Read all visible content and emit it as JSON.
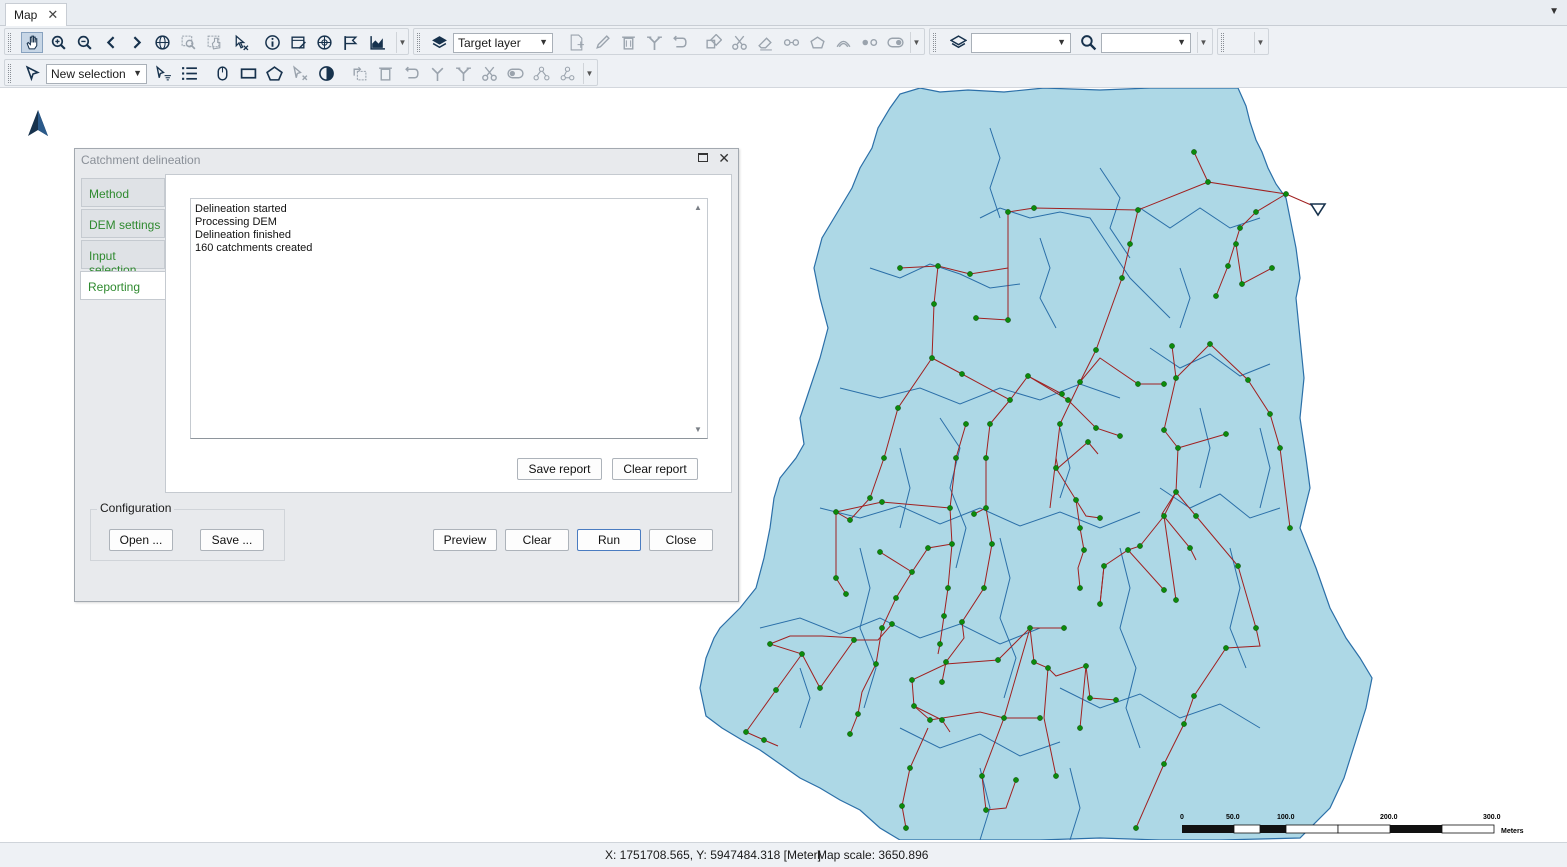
{
  "tab": {
    "title": "Map",
    "close": "✕",
    "menu_arrow": "▼"
  },
  "toolbar1": {
    "target_layer": "Target layer",
    "icons": [
      "pan-icon",
      "zoom-in-icon",
      "zoom-out-icon",
      "back-icon",
      "forward-icon",
      "full-extent-icon",
      "zoom-selection-icon",
      "pan-selection-icon",
      "clear-selection-icon",
      "info-icon",
      "edit-attributes-icon",
      "network-icon",
      "flag-icon",
      "chart-icon",
      "layer-icon",
      "new-feature-icon",
      "edit-icon",
      "delete-icon",
      "split-icon",
      "undo-icon",
      "merge-icon",
      "cut-icon",
      "eraser-icon",
      "vertex-icon",
      "polygon-icon",
      "buffer-icon",
      "points-icon",
      "toggle-icon",
      "layers-stack-icon",
      "search-icon"
    ],
    "combo_empty_1": "",
    "combo_empty_2": ""
  },
  "toolbar2": {
    "selection_mode": "New selection"
  },
  "map": {
    "colors": {
      "catchment_fill": "#add8e6",
      "catchment_stroke": "#2b6fa8",
      "network_line": "#a02020",
      "node": "#0b8a0b"
    },
    "scalebar": {
      "labels": [
        "0",
        "50.0",
        "100.0",
        "200.0",
        "300.0"
      ],
      "unit": "Meters"
    }
  },
  "statusbar": {
    "coords": "X: 1751708.565, Y: 5947484.318 [Meter]",
    "scale": "Map scale: 3650.896"
  },
  "dialog": {
    "title": "Catchment delineation",
    "tabs": [
      "Method",
      "DEM settings",
      "Input selection",
      "Reporting"
    ],
    "selected_tab": "Reporting",
    "log": [
      "Delineation started",
      "Processing DEM",
      "Delineation finished",
      "160 catchments created"
    ],
    "save_report": "Save report",
    "clear_report": "Clear report",
    "configuration": "Configuration",
    "open": "Open ...",
    "save": "Save ...",
    "preview": "Preview",
    "clear": "Clear",
    "run": "Run",
    "close": "Close"
  }
}
